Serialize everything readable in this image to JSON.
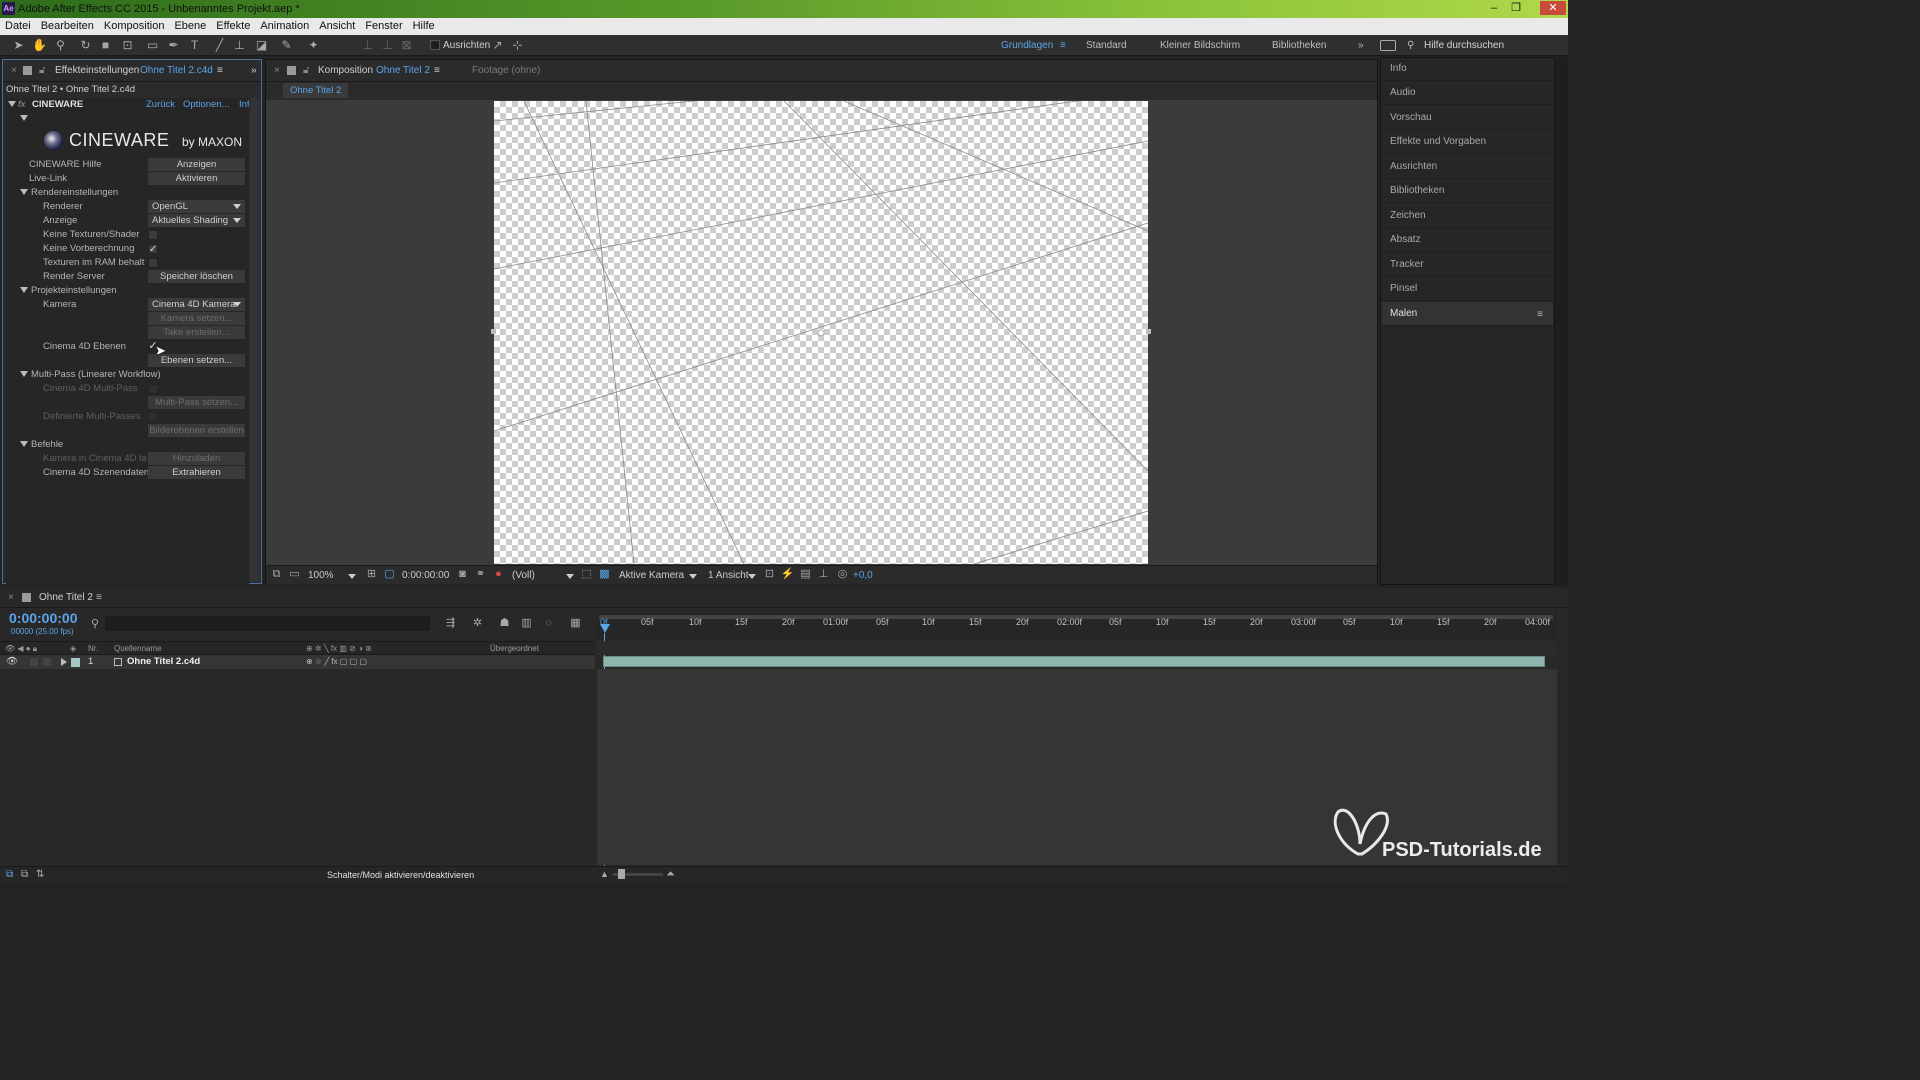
{
  "title": "Adobe After Effects CC 2015 - Unbenanntes Projekt.aep *",
  "app_badge": "Ae",
  "menu": [
    "Datei",
    "Bearbeiten",
    "Komposition",
    "Ebene",
    "Effekte",
    "Animation",
    "Ansicht",
    "Fenster",
    "Hilfe"
  ],
  "toolbar": {
    "align_label": "Ausrichten",
    "workspaces": [
      "Grundlagen",
      "Standard",
      "Kleiner Bildschirm",
      "Bibliotheken"
    ],
    "search_placeholder": "Hilfe durchsuchen"
  },
  "effects_panel": {
    "tab_label": "Effekteinstellungen",
    "tab_file": "Ohne Titel 2.c4d",
    "breadcrumb": "Ohne Titel 2 • Ohne Titel 2.c4d",
    "effect_name": "CINEWARE",
    "reset": "Zurück",
    "options": "Optionen...",
    "info": "Inf",
    "logo_text": "CINEWARE",
    "logo_by": "by MAXON",
    "help_label": "CINEWARE Hilfe",
    "help_btn": "Anzeigen",
    "livelink_label": "Live-Link",
    "livelink_btn": "Aktivieren",
    "render_section": "Rendereinstellungen",
    "renderer_label": "Renderer",
    "renderer_value": "OpenGL",
    "display_label": "Anzeige",
    "display_value": "Aktuelles Shading",
    "no_textures": "Keine Texturen/Shader",
    "no_precalc": "Keine Vorberechnung",
    "textures_ram": "Texturen im RAM behalt",
    "render_server": "Render Server",
    "render_server_btn": "Speicher löschen",
    "project_section": "Projekteinstellungen",
    "camera_label": "Kamera",
    "camera_value": "Cinema 4D Kamera",
    "set_camera": "Kamera setzen...",
    "create_take": "Take erstellen...",
    "c4d_layers": "Cinema 4D Ebenen",
    "set_layers": "Ebenen setzen...",
    "multipass_section": "Multi-Pass (Linearer Workflow)",
    "c4d_multipass": "Cinema 4D Multi-Pass",
    "set_multipass": "Multi-Pass setzen...",
    "defined_multipass": "Definierte Multi-Passes",
    "create_image_layers": "Bilderebenen erstellen",
    "commands_section": "Befehle",
    "camera_in_c4d": "Kamera in Cinema 4D la",
    "add_btn": "Hinzuladen",
    "scene_data": "Cinema 4D Szenendaten",
    "extract_btn": "Extrahieren"
  },
  "comp_panel": {
    "tab_label": "Komposition",
    "tab_name": "Ohne Titel 2",
    "footage_tab": "Footage (ohne)",
    "comp_tab": "Ohne Titel 2",
    "zoom": "100%",
    "timecode": "0:00:00:00",
    "resolution": "(Voll)",
    "camera": "Aktive Kamera",
    "views": "1 Ansicht",
    "exposure": "+0,0"
  },
  "right_panels": [
    "Info",
    "Audio",
    "Vorschau",
    "Effekte und Vorgaben",
    "Ausrichten",
    "Bibliotheken",
    "Zeichen",
    "Absatz",
    "Tracker",
    "Pinsel",
    "Malen"
  ],
  "timeline": {
    "tab_name": "Ohne Titel 2",
    "timecode": "0:00:00:00",
    "fps": "00000 (25.00 fps)",
    "col_nr": "Nr.",
    "col_source": "Quellenname",
    "col_parent": "Übergeordnet",
    "layer_num": "1",
    "layer_name": "Ohne Titel 2.c4d",
    "ruler": [
      "0f",
      "05f",
      "10f",
      "15f",
      "20f",
      "01:00f",
      "05f",
      "10f",
      "15f",
      "20f",
      "02:00f",
      "05f",
      "10f",
      "15f",
      "20f",
      "03:00f",
      "05f",
      "10f",
      "15f",
      "20f",
      "04:00f"
    ],
    "footer_toggle": "Schalter/Modi aktivieren/deaktivieren"
  },
  "watermark": "PSD-Tutorials.de",
  "colors": {
    "accent": "#5ba4e8",
    "titlebar_green": "#8cc43a",
    "timecode": "#5ba4e8"
  }
}
